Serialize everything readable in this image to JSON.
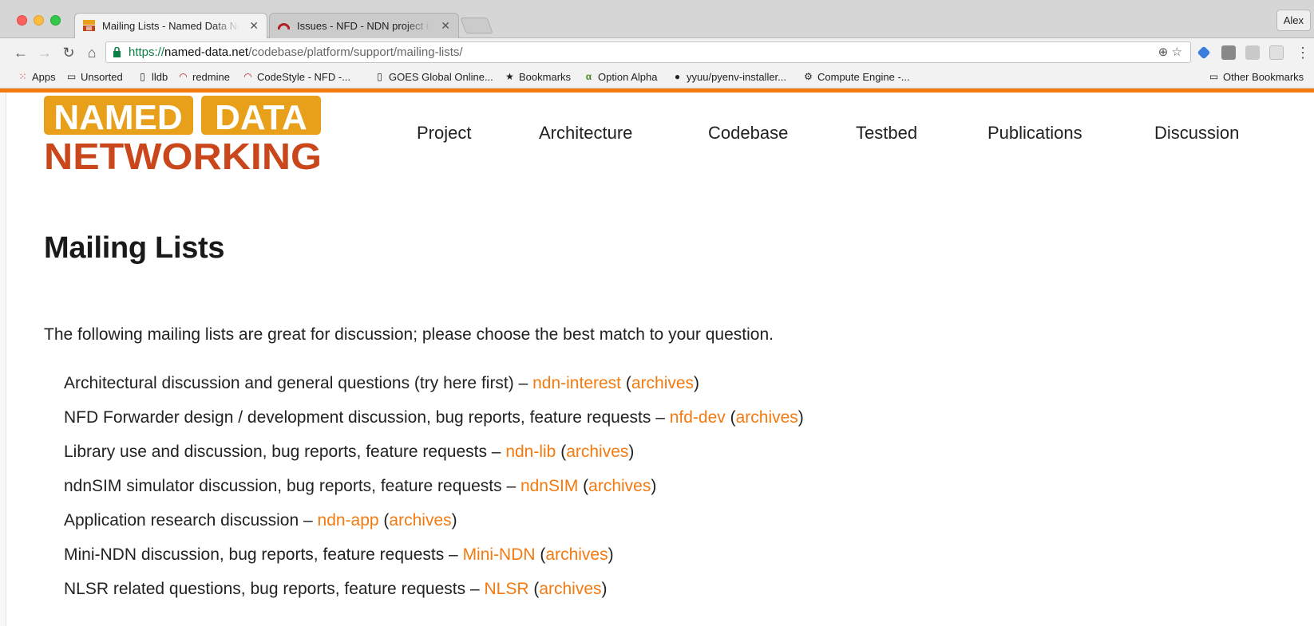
{
  "browser": {
    "tabs": [
      {
        "title": "Mailing Lists - Named Data Networking",
        "active": true,
        "favicon": "ndn-favicon"
      },
      {
        "title": "Issues - NFD - NDN project issue tracker",
        "active": false,
        "favicon": "redmine-favicon"
      }
    ],
    "profile_name": "Alex",
    "url": {
      "scheme": "https://",
      "host": "named-data.net",
      "path": "/codebase/platform/support/mailing-lists/"
    },
    "bookmarks": [
      {
        "label": "Apps",
        "icon": "apps-grid-icon"
      },
      {
        "label": "Unsorted",
        "icon": "folder-icon"
      },
      {
        "label": "lldb",
        "icon": "page-icon"
      },
      {
        "label": "redmine",
        "icon": "redmine-icon"
      },
      {
        "label": "CodeStyle - NFD -...",
        "icon": "redmine-icon"
      },
      {
        "label": "GOES Global Online...",
        "icon": "page-icon"
      },
      {
        "label": "Bookmarks",
        "icon": "star-icon"
      },
      {
        "label": "Option Alpha",
        "icon": "option-alpha-icon"
      },
      {
        "label": "yyuu/pyenv-installer...",
        "icon": "github-icon"
      },
      {
        "label": "Compute Engine -...",
        "icon": "chip-icon"
      }
    ],
    "other_bookmarks": "Other Bookmarks"
  },
  "site": {
    "logo_line1_a": "NAMED",
    "logo_line1_b": "DATA",
    "logo_line2": "NETWORKING",
    "nav": [
      "Project",
      "Architecture",
      "Codebase",
      "Testbed",
      "Publications",
      "Discussion"
    ],
    "accent": "#f47a0f"
  },
  "page": {
    "title": "Mailing Lists",
    "intro": "The following mailing lists are great for discussion; please choose the best match to your question.",
    "lists": [
      {
        "desc": "Architectural discussion and general questions (try here first) – ",
        "name": "ndn-interest",
        "archives": "archives"
      },
      {
        "desc": "NFD Forwarder design / development discussion, bug reports, feature requests – ",
        "name": "nfd-dev",
        "archives": "archives"
      },
      {
        "desc": "Library use and discussion, bug reports, feature requests – ",
        "name": "ndn-lib",
        "archives": "archives"
      },
      {
        "desc": "ndnSIM simulator discussion, bug reports, feature requests – ",
        "name": "ndnSIM",
        "archives": "archives"
      },
      {
        "desc": "Application research discussion – ",
        "name": "ndn-app",
        "archives": "archives"
      },
      {
        "desc": "Mini-NDN discussion, bug reports, feature requests – ",
        "name": "Mini-NDN",
        "archives": "archives"
      },
      {
        "desc": "NLSR related questions, bug reports, feature requests – ",
        "name": "NLSR",
        "archives": "archives"
      }
    ]
  }
}
